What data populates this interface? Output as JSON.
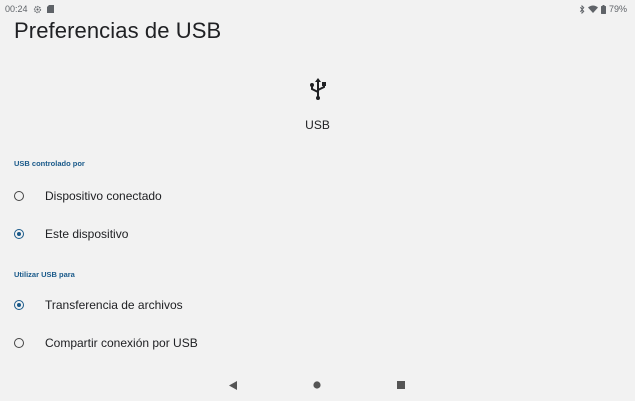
{
  "status_bar": {
    "time": "00:24",
    "battery": "79%",
    "icons": [
      "settings-gear-icon",
      "sd-card-icon",
      "bluetooth-icon",
      "wifi-icon",
      "battery-icon"
    ]
  },
  "page": {
    "title": "Preferencias de USB"
  },
  "usb": {
    "icon": "usb-icon",
    "label": "USB"
  },
  "sections": {
    "controlled_by": {
      "header": "USB controlado por",
      "options": [
        {
          "label": "Dispositivo conectado",
          "checked": false
        },
        {
          "label": "Este dispositivo",
          "checked": true
        }
      ]
    },
    "use_for": {
      "header": "Utilizar USB para",
      "options": [
        {
          "label": "Transferencia de archivos",
          "checked": true
        },
        {
          "label": "Compartir conexión por USB",
          "checked": false
        }
      ]
    }
  },
  "nav_bar": {
    "buttons": [
      "back-icon",
      "home-icon",
      "recents-icon"
    ]
  },
  "colors": {
    "accent": "#1a5a8a",
    "background": "#f2f2f2",
    "text": "#202124"
  }
}
